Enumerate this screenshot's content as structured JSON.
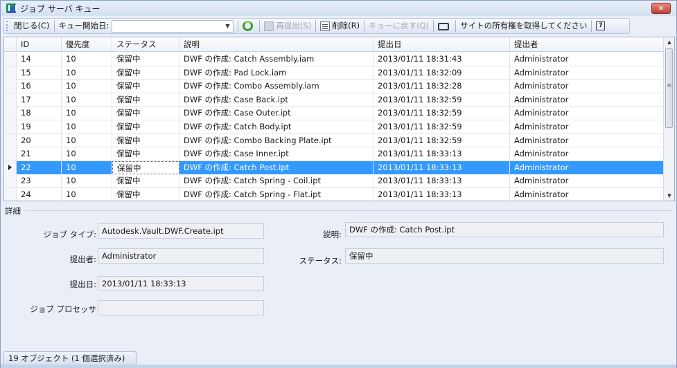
{
  "window": {
    "title": "ジョブ サーバ キュー",
    "close_label": "×"
  },
  "toolbar": {
    "close_label": "閉じる(C)",
    "queue_start_label": "キュー開始日:",
    "queue_start_value": "",
    "resubmit_label": "再提出(S)",
    "delete_label": "削除(R)",
    "requeue_label": "キューに戻す(Q)",
    "ownership_label": "サイトの所有権を取得してください",
    "help_label": "?"
  },
  "grid": {
    "columns": [
      "ID",
      "優先度",
      "ステータス",
      "説明",
      "提出日",
      "提出者"
    ],
    "rows": [
      [
        "14",
        "10",
        "保留中",
        "DWF の作成: Catch Assembly.iam",
        "2013/01/11 18:31:43",
        "Administrator"
      ],
      [
        "15",
        "10",
        "保留中",
        "DWF の作成: Pad Lock.iam",
        "2013/01/11 18:32:09",
        "Administrator"
      ],
      [
        "16",
        "10",
        "保留中",
        "DWF の作成: Combo Assembly.iam",
        "2013/01/11 18:32:28",
        "Administrator"
      ],
      [
        "17",
        "10",
        "保留中",
        "DWF の作成: Case Back.ipt",
        "2013/01/11 18:32:59",
        "Administrator"
      ],
      [
        "18",
        "10",
        "保留中",
        "DWF の作成: Case Outer.ipt",
        "2013/01/11 18:32:59",
        "Administrator"
      ],
      [
        "19",
        "10",
        "保留中",
        "DWF の作成: Catch Body.ipt",
        "2013/01/11 18:32:59",
        "Administrator"
      ],
      [
        "20",
        "10",
        "保留中",
        "DWF の作成: Combo Backing Plate.ipt",
        "2013/01/11 18:32:59",
        "Administrator"
      ],
      [
        "21",
        "10",
        "保留中",
        "DWF の作成: Case Inner.ipt",
        "2013/01/11 18:33:13",
        "Administrator"
      ],
      [
        "22",
        "10",
        "保留中",
        "DWF の作成: Catch Post.ipt",
        "2013/01/11 18:33:13",
        "Administrator"
      ],
      [
        "23",
        "10",
        "保留中",
        "DWF の作成: Catch Spring - Coil.ipt",
        "2013/01/11 18:33:13",
        "Administrator"
      ],
      [
        "24",
        "10",
        "保留中",
        "DWF の作成: Catch Spring - Flat.ipt",
        "2013/01/11 18:33:13",
        "Administrator"
      ]
    ],
    "selected_index": 8
  },
  "details": {
    "section_label": "詳細",
    "job_type_label": "ジョブ タイプ:",
    "job_type_value": "Autodesk.Vault.DWF.Create.ipt",
    "submitter_label": "提出者:",
    "submitter_value": "Administrator",
    "submit_date_label": "提出日:",
    "submit_date_value": "2013/01/11 18:33:13",
    "processor_label": "ジョブ プロセッサ",
    "processor_value": "",
    "description_label": "説明:",
    "description_value": "DWF の作成: Catch Post.ipt",
    "status_label": "ステータス:",
    "status_value": "保留中"
  },
  "statusbar": {
    "text": "19 オブジェクト (1 個選択済み)"
  }
}
